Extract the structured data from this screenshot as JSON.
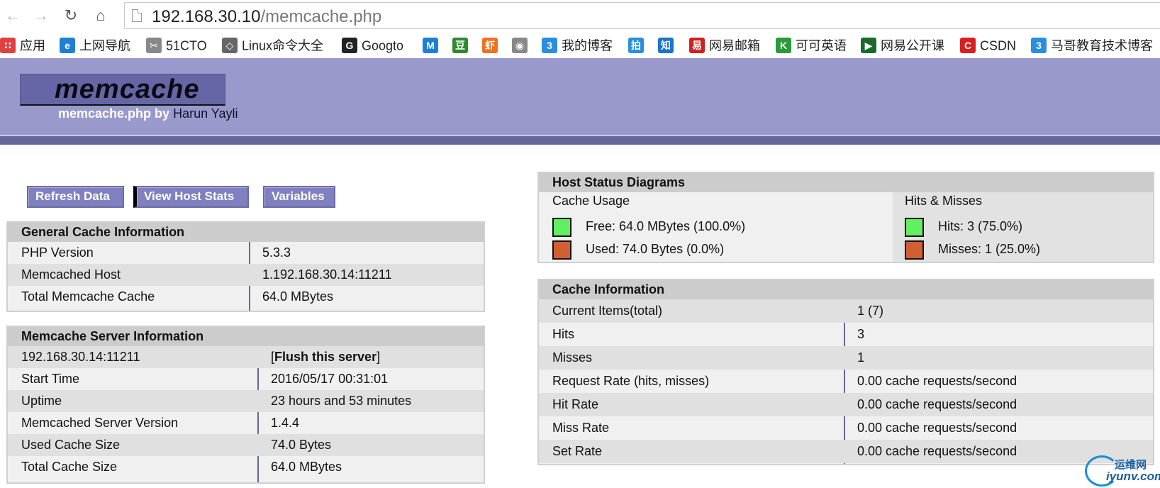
{
  "browser": {
    "url_host": "192.168.30.10",
    "url_path": "/memcache.php",
    "bookmarks": [
      {
        "label": "应用",
        "icon": "apps-grid-icon",
        "color": "#e04040"
      },
      {
        "label": "上网导航",
        "icon": "ie-icon",
        "color": "#1e7fd8"
      },
      {
        "label": "51CTO",
        "icon": "paperclip-icon",
        "color": "#888888"
      },
      {
        "label": "Linux命令大全",
        "icon": "diamond-icon",
        "color": "#666666"
      },
      {
        "label": "Googto",
        "icon": "g-logo-icon",
        "color": "#222222"
      },
      {
        "label": "",
        "icon": "m-logo-icon",
        "color": "#1e7fd8"
      },
      {
        "label": "",
        "icon": "douban-icon",
        "color": "#2d8a2d"
      },
      {
        "label": "",
        "icon": "xiami-icon",
        "color": "#f07020"
      },
      {
        "label": "",
        "icon": "owl-icon",
        "color": "#888888"
      },
      {
        "label": "我的博客",
        "icon": "blog-icon",
        "color": "#2a8ee0"
      },
      {
        "label": "",
        "icon": "pai-icon",
        "color": "#2a8ee0"
      },
      {
        "label": "",
        "icon": "zhihu-icon",
        "color": "#1a74d0"
      },
      {
        "label": "网易邮箱",
        "icon": "netease-mail-icon",
        "color": "#d02020"
      },
      {
        "label": "可可英语",
        "icon": "keke-icon",
        "color": "#2a9a3a"
      },
      {
        "label": "网易公开课",
        "icon": "open-course-icon",
        "color": "#1a6a2a"
      },
      {
        "label": "CSDN",
        "icon": "csdn-icon",
        "color": "#d82020"
      },
      {
        "label": "马哥教育技术博客",
        "icon": "blog-icon",
        "color": "#2a8ee0"
      }
    ]
  },
  "header": {
    "logo": "memcache",
    "byline_script": "memcache.php by",
    "byline_author": "Harun Yayli"
  },
  "menu": {
    "refresh": "Refresh Data",
    "host_stats": "View Host Stats",
    "variables": "Variables"
  },
  "general": {
    "title": "General Cache Information",
    "rows": [
      {
        "key": "PHP Version",
        "value": "5.3.3"
      },
      {
        "key": "Memcached Host",
        "value": "1.192.168.30.14:11211"
      },
      {
        "key": "Total Memcache Cache",
        "value": "64.0 MBytes"
      }
    ]
  },
  "server": {
    "title": "Memcache Server Information",
    "host": "192.168.30.14:11211",
    "flush_open": "[",
    "flush_label": "Flush this server",
    "flush_close": "]",
    "rows": [
      {
        "key": "Start Time",
        "value": "2016/05/17 00:31:01"
      },
      {
        "key": "Uptime",
        "value": "23 hours and 53 minutes"
      },
      {
        "key": "Memcached Server Version",
        "value": "1.4.4"
      },
      {
        "key": "Used Cache Size",
        "value": "74.0 Bytes"
      },
      {
        "key": "Total Cache Size",
        "value": "64.0 MBytes"
      }
    ]
  },
  "diagrams": {
    "title": "Host Status Diagrams",
    "usage": {
      "title": "Cache Usage",
      "free": "Free: 64.0 MBytes (100.0%)",
      "used": "Used: 74.0 Bytes (0.0%)"
    },
    "hits": {
      "title": "Hits & Misses",
      "hits": "Hits: 3 (75.0%)",
      "misses": "Misses: 1 (25.0%)"
    },
    "colors": {
      "green": "#60f060",
      "orange": "#d06030"
    }
  },
  "cache": {
    "title": "Cache Information",
    "rows": [
      {
        "key": "Current Items(total)",
        "value": "1 (7)"
      },
      {
        "key": "Hits",
        "value": "3"
      },
      {
        "key": "Misses",
        "value": "1"
      },
      {
        "key": "Request Rate (hits, misses)",
        "value": "0.00 cache requests/second"
      },
      {
        "key": "Hit Rate",
        "value": "0.00 cache requests/second"
      },
      {
        "key": "Miss Rate",
        "value": "0.00 cache requests/second"
      },
      {
        "key": "Set Rate",
        "value": "0.00 cache requests/second"
      }
    ]
  },
  "watermark": {
    "line1": "运维网",
    "line2": "iyunv.com"
  }
}
